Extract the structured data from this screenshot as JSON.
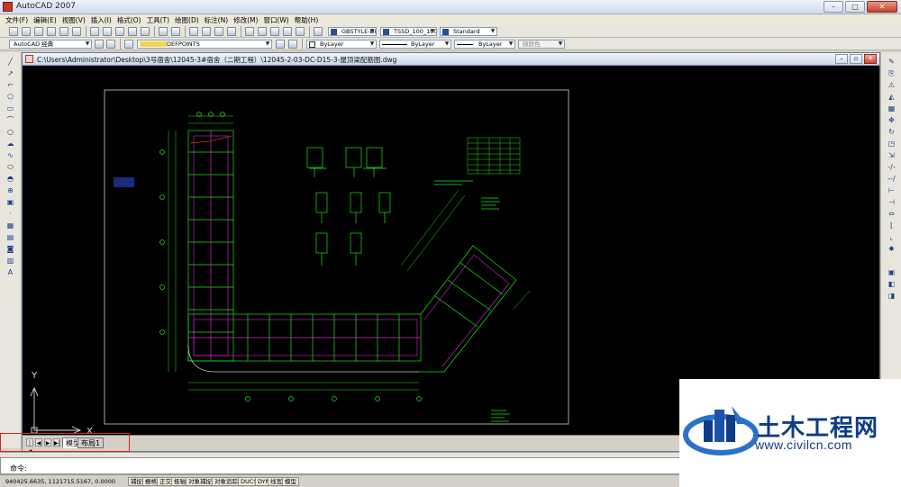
{
  "window": {
    "title": "AutoCAD 2007"
  },
  "menu": [
    "文件(F)",
    "编辑(E)",
    "视图(V)",
    "插入(I)",
    "格式(O)",
    "工具(T)",
    "绘图(D)",
    "标注(N)",
    "修改(M)",
    "窗口(W)",
    "帮助(H)"
  ],
  "toolbar": {
    "text_style": "GBSTYLE-DIM",
    "dim_style": "TSSD_100_100",
    "table_style": "Standard",
    "workspace": "AutoCAD 经典",
    "layer": "DEFPOINTS",
    "color": "ByLayer",
    "linetype": "ByLayer",
    "lineweight": "ByLayer",
    "plot_style": "随颜色"
  },
  "drawing": {
    "path": "C:\\Users\\Administrator\\Desktop\\3号宿舍\\12045-3#宿舍（二期工程）\\12045-2-03-DC-D15-3-屋顶梁配筋图.dwg",
    "ucs_x": "X",
    "ucs_y": "Y"
  },
  "layout_tabs": {
    "model": "模型",
    "layout": "布局1"
  },
  "command": {
    "prompt": "命令:"
  },
  "status": {
    "coordinates": "940425.6635, 1121715.5167, 0.0000",
    "buttons": [
      "捕捉",
      "栅格",
      "正交",
      "极轴",
      "对象捕捉",
      "对象追踪",
      "DUCS",
      "DYN",
      "线宽",
      "模型"
    ]
  },
  "watermark": {
    "title": "土木工程网",
    "url": "www.civilcn.com"
  },
  "colors": {
    "accent": "#0e3c87",
    "canvas": "#000000",
    "drawing_green": "#22e01a",
    "drawing_magenta": "#d42ad4"
  }
}
